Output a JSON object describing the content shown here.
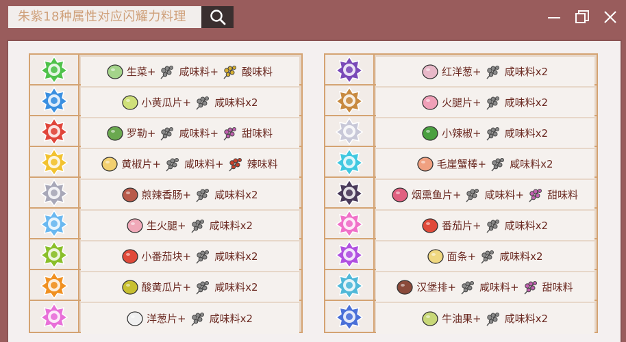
{
  "window": {
    "title": "朱紫18种属性对应闪耀力料理"
  },
  "left_rows": [
    {
      "type": "grass",
      "color": "#4fc24a",
      "ingredient_icon": "lettuce-icon",
      "ingredient_color": "#a4d48a",
      "parts": [
        {
          "icon": "lettuce-icon",
          "color": "#a4d48a",
          "text": "生菜+"
        },
        {
          "icon": "herb-icon",
          "color": "#8a8a8a",
          "text": "咸味料+"
        },
        {
          "icon": "herb-yellow-icon",
          "color": "#d8b030",
          "text": "酸味料"
        }
      ]
    },
    {
      "type": "water",
      "color": "#3a8fe0",
      "parts": [
        {
          "icon": "cucumber-icon",
          "color": "#cfe07a",
          "text": "小黄瓜片+"
        },
        {
          "icon": "herb-icon",
          "color": "#8a8a8a",
          "text": "咸味料x2"
        }
      ]
    },
    {
      "type": "fire",
      "color": "#e0453a",
      "parts": [
        {
          "icon": "basil-icon",
          "color": "#6aa84f",
          "text": "罗勒+"
        },
        {
          "icon": "herb-icon",
          "color": "#8a8a8a",
          "text": "咸味料+"
        },
        {
          "icon": "herb-pink-icon",
          "color": "#c060b0",
          "text": "甜味料"
        }
      ]
    },
    {
      "type": "electric",
      "color": "#f2c230",
      "parts": [
        {
          "icon": "yellow-pepper-icon",
          "color": "#f2d070",
          "text": "黄椒片+"
        },
        {
          "icon": "herb-icon",
          "color": "#8a8a8a",
          "text": "咸味料+"
        },
        {
          "icon": "herb-red-icon",
          "color": "#c8402a",
          "text": "辣味料"
        }
      ]
    },
    {
      "type": "normal",
      "color": "#a8a8b8",
      "parts": [
        {
          "icon": "sausage-icon",
          "color": "#b85a4a",
          "text": "煎辣香肠+"
        },
        {
          "icon": "herb-icon",
          "color": "#8a8a8a",
          "text": "咸味料x2"
        }
      ]
    },
    {
      "type": "ice",
      "color": "#6ab8f0",
      "parts": [
        {
          "icon": "ham-icon",
          "color": "#f0a8b8",
          "text": "生火腿+"
        },
        {
          "icon": "herb-icon",
          "color": "#8a8a8a",
          "text": "咸味料x2"
        }
      ]
    },
    {
      "type": "bug",
      "color": "#8abf2a",
      "parts": [
        {
          "icon": "tomato-slice-icon",
          "color": "#e04a3a",
          "text": "小番茄块+"
        },
        {
          "icon": "herb-icon",
          "color": "#8a8a8a",
          "text": "咸味料x2"
        }
      ]
    },
    {
      "type": "fighting",
      "color": "#f09020",
      "parts": [
        {
          "icon": "pickle-icon",
          "color": "#c8c030",
          "text": "酸黄瓜片+"
        },
        {
          "icon": "herb-icon",
          "color": "#8a8a8a",
          "text": "咸味料x2"
        }
      ]
    },
    {
      "type": "fairy",
      "color": "#e870d8",
      "parts": [
        {
          "icon": "onion-icon",
          "color": "#f0f0f0",
          "text": "洋葱片+"
        },
        {
          "icon": "herb-icon",
          "color": "#8a8a8a",
          "text": "咸味料x2"
        }
      ]
    }
  ],
  "right_rows": [
    {
      "type": "ghost",
      "color": "#7a4ab8",
      "parts": [
        {
          "icon": "red-onion-icon",
          "color": "#e8b8c8",
          "text": "红洋葱+"
        },
        {
          "icon": "herb-icon",
          "color": "#8a8a8a",
          "text": "咸味料x2"
        }
      ]
    },
    {
      "type": "ground",
      "color": "#c88a40",
      "parts": [
        {
          "icon": "ham-slice-icon",
          "color": "#f0a0b8",
          "text": "火腿片+"
        },
        {
          "icon": "herb-icon",
          "color": "#8a8a8a",
          "text": "咸味料x2"
        }
      ]
    },
    {
      "type": "flying",
      "color": "#c8c8d8",
      "parts": [
        {
          "icon": "jalapeno-icon",
          "color": "#4aa040",
          "text": "小辣椒+"
        },
        {
          "icon": "herb-icon",
          "color": "#8a8a8a",
          "text": "咸味料x2"
        }
      ]
    },
    {
      "type": "psychic-ice",
      "color": "#40c8e0",
      "parts": [
        {
          "icon": "crab-stick-icon",
          "color": "#f0a080",
          "text": "毛崖蟹棒+"
        },
        {
          "icon": "herb-icon",
          "color": "#8a8a8a",
          "text": "咸味料x2"
        }
      ]
    },
    {
      "type": "dark",
      "color": "#4a3a5a",
      "parts": [
        {
          "icon": "smoked-fish-icon",
          "color": "#e06080",
          "text": "烟熏鱼片+"
        },
        {
          "icon": "herb-icon",
          "color": "#8a8a8a",
          "text": "咸味料+"
        },
        {
          "icon": "herb-pink-icon",
          "color": "#c060b0",
          "text": "甜味料"
        }
      ]
    },
    {
      "type": "psychic",
      "color": "#f070c8",
      "parts": [
        {
          "icon": "tomato-icon",
          "color": "#e04a3a",
          "text": "番茄片+"
        },
        {
          "icon": "herb-icon",
          "color": "#8a8a8a",
          "text": "咸味料x2"
        }
      ]
    },
    {
      "type": "poison",
      "color": "#b050e0",
      "parts": [
        {
          "icon": "noodles-icon",
          "color": "#f0d880",
          "text": "面条+"
        },
        {
          "icon": "herb-icon",
          "color": "#8a8a8a",
          "text": "咸味料x2"
        }
      ]
    },
    {
      "type": "steel",
      "color": "#50b8d8",
      "parts": [
        {
          "icon": "hamburger-icon",
          "color": "#8a4a3a",
          "text": "汉堡排+"
        },
        {
          "icon": "herb-icon",
          "color": "#8a8a8a",
          "text": "咸味料+"
        },
        {
          "icon": "herb-pink-icon",
          "color": "#c060b0",
          "text": "甜味料"
        }
      ]
    },
    {
      "type": "dragon",
      "color": "#4a70d8",
      "parts": [
        {
          "icon": "avocado-icon",
          "color": "#c8d878",
          "text": "牛油果+"
        },
        {
          "icon": "herb-icon",
          "color": "#8a8a8a",
          "text": "咸味料x2"
        }
      ]
    }
  ]
}
